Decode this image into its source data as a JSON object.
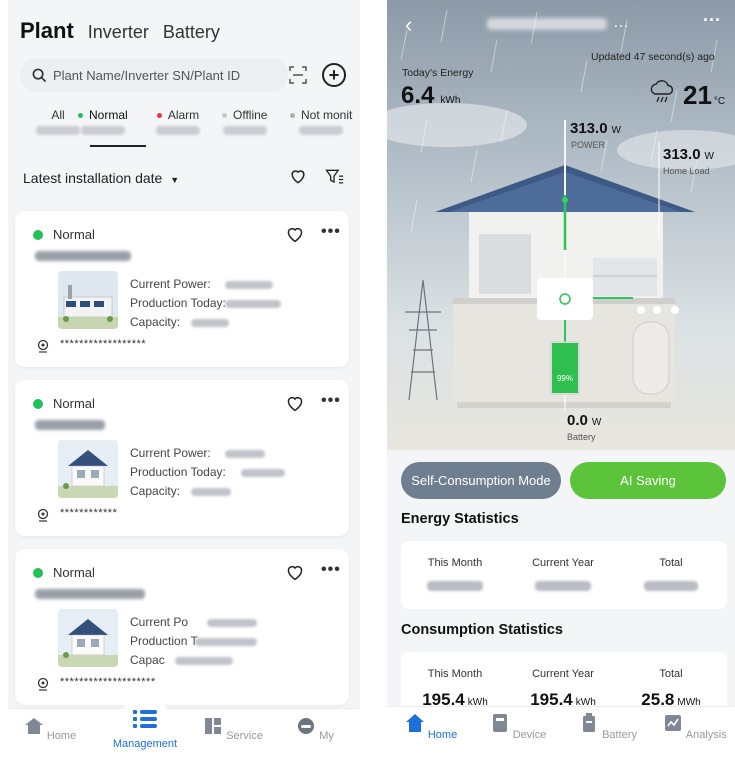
{
  "left": {
    "tabs": [
      "Plant",
      "Inverter",
      "Battery"
    ],
    "search_placeholder": "Plant Name/Inverter SN/Plant ID",
    "statuses": [
      {
        "label": "All",
        "color": ""
      },
      {
        "label": "Normal",
        "color": "#23c05a"
      },
      {
        "label": "Alarm",
        "color": "#e8334a"
      },
      {
        "label": "Offline",
        "color": "#c8c8c8"
      },
      {
        "label": "Not monit",
        "color": "#b0b0b0"
      }
    ],
    "sort_label": "Latest installation date",
    "cards": [
      {
        "status": "Normal",
        "power_label": "Current Power:",
        "production_label": "Production Today:",
        "capacity_label": "Capacity:",
        "address": "******************"
      },
      {
        "status": "Normal",
        "power_label": "Current Power:",
        "production_label": "Production Today:",
        "capacity_label": "Capacity:",
        "address": "************"
      },
      {
        "status": "Normal",
        "power_label": "Current Po",
        "production_label": "Production T",
        "capacity_label": "Capac",
        "address": "********************"
      }
    ],
    "nav": [
      {
        "label": "Home",
        "icon": "home-icon"
      },
      {
        "label": "Management",
        "icon": "list-icon"
      },
      {
        "label": "Service",
        "icon": "service-icon"
      },
      {
        "label": "My",
        "icon": "user-icon"
      }
    ]
  },
  "right": {
    "updated": "Updated 47 second(s) ago",
    "todays_energy_label": "Today's Energy",
    "todays_energy_value": "6.4",
    "todays_energy_unit": "kWh",
    "temperature": "21",
    "temperature_unit": "°C",
    "power": {
      "value": "313.0",
      "unit": "W",
      "label": "POWER"
    },
    "home_load": {
      "value": "313.0",
      "unit": "W",
      "label": "Home Load"
    },
    "battery": {
      "value": "0.0",
      "unit": "W",
      "label": "Battery",
      "soc": "99%",
      "level": 0.99
    },
    "modes": [
      "Self-Consumption Mode",
      "AI Saving"
    ],
    "energy_stats": {
      "title": "Energy Statistics",
      "cols": [
        "This Month",
        "Current Year",
        "Total"
      ]
    },
    "consumption_stats": {
      "title": "Consumption Statistics",
      "cols": [
        "This Month",
        "Current Year",
        "Total"
      ],
      "values": [
        {
          "v": "195.4",
          "u": "kWh"
        },
        {
          "v": "195.4",
          "u": "kWh"
        },
        {
          "v": "25.8",
          "u": "MWh"
        }
      ]
    },
    "nav": [
      {
        "label": "Home",
        "icon": "home-icon"
      },
      {
        "label": "Device",
        "icon": "device-icon"
      },
      {
        "label": "Battery",
        "icon": "battery-icon"
      },
      {
        "label": "Analysis",
        "icon": "analysis-icon"
      }
    ]
  },
  "colors": {
    "accent": "#1e6fd9",
    "green": "#23c05a",
    "ai_green": "#5cc43a",
    "mode_gray": "#6f7f8f"
  }
}
